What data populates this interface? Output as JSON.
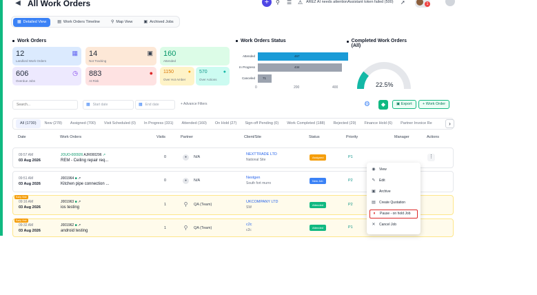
{
  "header": {
    "title": "All Work Orders",
    "alert": "AREZ AI needs attentionAssistant token failed (500)",
    "avatar_badge": "1"
  },
  "view_tabs": [
    {
      "label": "Detailed View",
      "icon": "grid-icon"
    },
    {
      "label": "Work Orders Timeline",
      "icon": "timeline-icon"
    },
    {
      "label": "Map View",
      "icon": "map-icon"
    },
    {
      "label": "Archived Jobs",
      "icon": "archive-icon"
    }
  ],
  "sections": {
    "work_orders": "Work Orders",
    "status": "Work Orders Status",
    "completed": "Completed Work Orders (All)"
  },
  "cards": {
    "landlord": {
      "value": "12",
      "label": "Landlord Work Orders"
    },
    "not_tracking": {
      "value": "14",
      "label": "Not Tracking"
    },
    "attended": {
      "value": "160",
      "label": "Attended"
    },
    "overdue": {
      "value": "606",
      "label": "Overdue Jobs"
    },
    "at_risk": {
      "value": "883",
      "label": "At Risk"
    },
    "over_hot_amber": {
      "value": "1150",
      "label": "Over Hot Amber"
    },
    "over_actions": {
      "value": "570",
      "label": "Over Actions"
    }
  },
  "chart_data": [
    {
      "type": "bar",
      "orientation": "horizontal",
      "categories": [
        "Attended",
        "In Progress",
        "Canceled"
      ],
      "values": [
        467,
        434,
        71
      ],
      "data_labels": [
        "467",
        "434",
        "71"
      ],
      "colors": [
        "#1a9bd7",
        "#9ca3af",
        "#9ca3af"
      ],
      "xlim": [
        0,
        400
      ],
      "xticks": [
        "0",
        "200",
        "400"
      ]
    },
    {
      "type": "pie",
      "variant": "donut-gauge",
      "values": [
        22.5,
        77.5
      ],
      "center_label": "22.5%"
    }
  ],
  "filters": {
    "search_placeholder": "Search...",
    "start_date": "Start date",
    "end_date": "End date",
    "advanced": "Advance Filters",
    "export": "Export",
    "add_work_order": "+ Work Order"
  },
  "status_tabs": [
    "All (1730)",
    "New (278)",
    "Assigned (700)",
    "Visit Scheduled (0)",
    "In Progress (331)",
    "Attended (160)",
    "On Hold (27)",
    "Sign-off Pending (0)",
    "Work Completed (188)",
    "Rejected (29)",
    "Finance Hold (6)",
    "Partner Invoice Re"
  ],
  "table": {
    "headers": [
      "Date",
      "Work Orders",
      "Visits",
      "Partner",
      "Client/Site",
      "Status",
      "Priority",
      "Manager",
      "Actions"
    ],
    "rows": [
      {
        "time": "09:57 AM",
        "date": "03 Aug 2026",
        "badge": "",
        "id": "JOUO-000926",
        "id2": "AJR000296",
        "title": "REM - Ceiling repair req...",
        "visits": "0",
        "partner": "N/A",
        "client": "NEXTTRADE LTD",
        "site": "National Site",
        "status": "Assigned",
        "priority": "P1"
      },
      {
        "time": "09:51 AM",
        "date": "03 Aug 2026",
        "badge": "",
        "id": "J001964",
        "id2": "",
        "title": "Kitchen pipe connection ...",
        "visits": "0",
        "partner": "N/A",
        "client": "Nextgen",
        "site": "South fort murro",
        "status": "New Job",
        "priority": "P2"
      },
      {
        "time": "09:16 AM",
        "date": "03 Aug 2026",
        "badge": "Early Visit",
        "id": "J001963",
        "id2": "",
        "title": "ios testing",
        "visits": "1",
        "partner": "QA (Team)",
        "client": "UKCOMPANY LTD",
        "site": "SW",
        "status": "Attended",
        "priority": "P2"
      },
      {
        "time": "09:32 AM",
        "date": "03 Aug 2026",
        "badge": "Early Visit",
        "id": "J001962",
        "id2": "",
        "title": "android testing",
        "visits": "1",
        "partner": "QA (Team)",
        "client": "c2c",
        "site": "c2c",
        "status": "Attended",
        "priority": "P1"
      }
    ]
  },
  "menu": [
    {
      "label": "View",
      "icon": "eye-icon"
    },
    {
      "label": "Edit",
      "icon": "edit-icon"
    },
    {
      "label": "Archive",
      "icon": "archive-icon"
    },
    {
      "label": "Create Quotation",
      "icon": "document-icon"
    },
    {
      "label": "Pause - on hold Job",
      "icon": "pause-icon"
    },
    {
      "label": "Cancel Job",
      "icon": "close-icon"
    }
  ]
}
